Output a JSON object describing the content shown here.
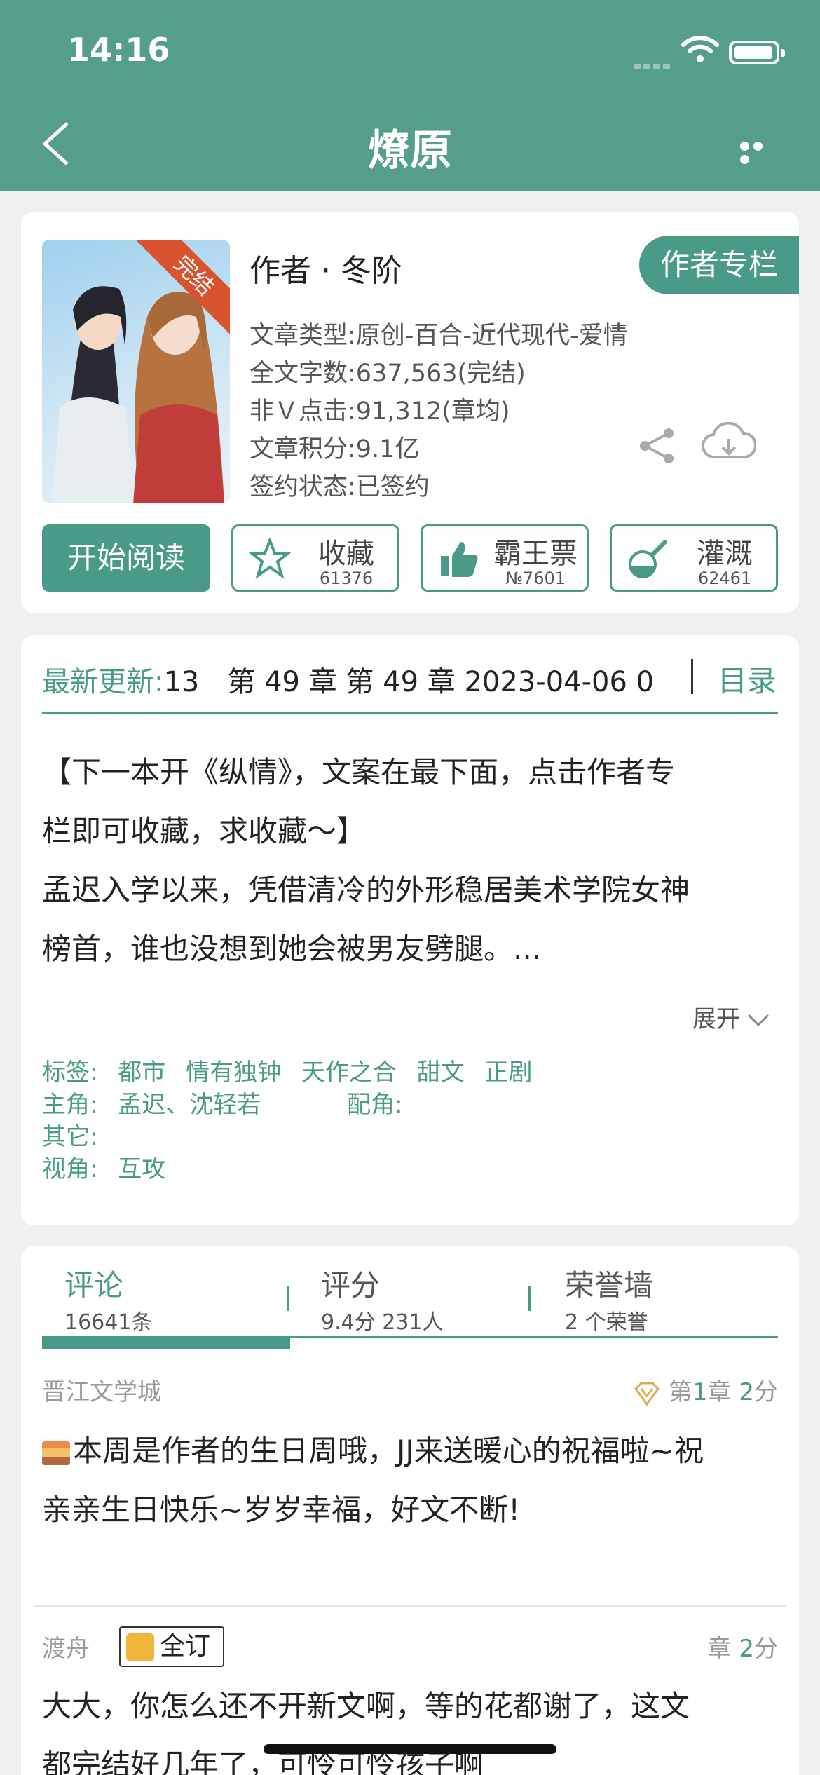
{
  "status_bar": {
    "time": "14:16"
  },
  "header": {
    "title": "燎原"
  },
  "book": {
    "cover_badge": "完结",
    "author": "作者 · 冬阶",
    "author_column": "作者专栏",
    "type": "文章类型:原创-百合-近代现代-爱情",
    "word_count": "全文字数:637,563(完结)",
    "clicks": "非Ｖ点击:91,312(章均)",
    "score": "文章积分:9.1亿",
    "sign_status": "签约状态:已签约"
  },
  "actions": {
    "start_read": "开始阅读",
    "collect": {
      "label": "收藏",
      "count": "61376"
    },
    "vote": {
      "label": "霸王票",
      "count": "№7601"
    },
    "water": {
      "label": "灌溉",
      "count": "62461"
    }
  },
  "update": {
    "label": "最新更新:",
    "text": "13　第 49 章 第 49 章 2023-04-06 0",
    "toc": "目录"
  },
  "synopsis": {
    "line1": "【下一本开《纵情》，文案在最下面，点击作者专",
    "line2": "栏即可收藏，求收藏～】",
    "line3": "孟迟入学以来，凭借清冷的外形稳居美术学院女神",
    "line4": "榜首，谁也没想到她会被男友劈腿。...",
    "expand": "展开"
  },
  "meta": {
    "tags_label": "标签:",
    "tags": [
      "都市",
      "情有独钟",
      "天作之合",
      "甜文",
      "正剧"
    ],
    "lead_label": "主角:",
    "lead": "孟迟、沈轻若",
    "support_label": "配角:",
    "other_label": "其它:",
    "pov_label": "视角:",
    "pov": "互攻"
  },
  "tabs": [
    {
      "title": "评论",
      "sub": "16641条"
    },
    {
      "title": "评分",
      "sub": "9.4分 231人"
    },
    {
      "title": "荣誉墙",
      "sub": "2 个荣誉"
    }
  ],
  "comments": [
    {
      "user": "晋江文学城",
      "chap_prefix": "第",
      "chap_num": "1",
      "chap_suffix": "章",
      "score": "2",
      "score_unit": "分",
      "line1": "本周是作者的生日周哦，JJ来送暖心的祝福啦~祝",
      "line2": "亲亲生日快乐~岁岁幸福，好文不断!"
    },
    {
      "user": "渡舟",
      "badge": "全订",
      "chap_suffix": "章",
      "score": "2",
      "score_unit": "分",
      "line1": "大大，你怎么还不开新文啊，等的花都谢了，这文",
      "line2": "都完结好几年了，可怜可怜孩子啊"
    }
  ],
  "colors": {
    "brand": "#569e8c",
    "accent": "#4a9a88",
    "ribbon": "#d9532f"
  }
}
